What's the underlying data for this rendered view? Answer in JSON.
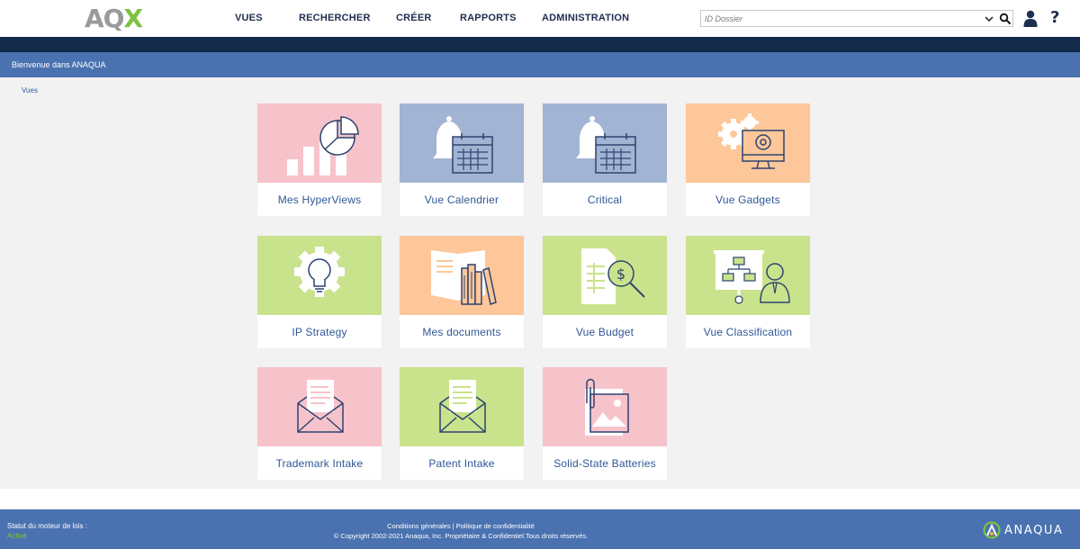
{
  "header": {
    "logo": {
      "a": "A",
      "q": "Q",
      "x": "X"
    },
    "nav": [
      "VUES",
      "RECHERCHER",
      "CRÉER",
      "RAPPORTS",
      "ADMINISTRATION"
    ],
    "search": {
      "placeholder": "ID Dossier",
      "value": ""
    },
    "user_icon": "user-icon",
    "help_label": "?"
  },
  "welcome": {
    "text": "Bienvenue dans ANAQUA"
  },
  "breadcrumb": {
    "text": "Vues"
  },
  "tiles": [
    {
      "label": "Mes HyperViews",
      "color": "#f7c3cb",
      "icon": "chart-pie-icon"
    },
    {
      "label": "Vue Calendrier",
      "color": "#a2b4d3",
      "icon": "bell-calendar-icon"
    },
    {
      "label": "Critical",
      "color": "#a2b4d3",
      "icon": "bell-calendar-icon"
    },
    {
      "label": "Vue Gadgets",
      "color": "#fdc79a",
      "icon": "gears-monitor-icon"
    },
    {
      "label": "IP Strategy",
      "color": "#c9e38c",
      "icon": "gear-bulb-icon"
    },
    {
      "label": "Mes documents",
      "color": "#fdc79a",
      "icon": "book-binders-icon"
    },
    {
      "label": "Vue Budget",
      "color": "#c9e38c",
      "icon": "budget-search-icon"
    },
    {
      "label": "Vue Classification",
      "color": "#c9e38c",
      "icon": "classification-board-icon"
    },
    {
      "label": "Trademark Intake",
      "color": "#f7c3cb",
      "icon": "envelope-letter-icon"
    },
    {
      "label": "Patent Intake",
      "color": "#c9e38c",
      "icon": "envelope-letter-icon"
    },
    {
      "label": "Solid-State Batteries",
      "color": "#f7c3cb",
      "icon": "image-clip-icon"
    }
  ],
  "footer": {
    "engine_label": "Statut du moteur de lois :",
    "engine_status": "Activé",
    "link_terms": "Conditions générales",
    "link_separator": "|",
    "link_privacy": "Politique de confidentialité",
    "copyright": "© Copyright 2002-2021 Anaqua, Inc. Propriétaire & Confidentiel.Tous droits réservés.",
    "brand": "ANAQUA"
  },
  "colors": {
    "nav_dark": "#142a4a",
    "accent_blue": "#4a72b0",
    "accent_green": "#7fc241",
    "tile_label": "#2f5796"
  }
}
